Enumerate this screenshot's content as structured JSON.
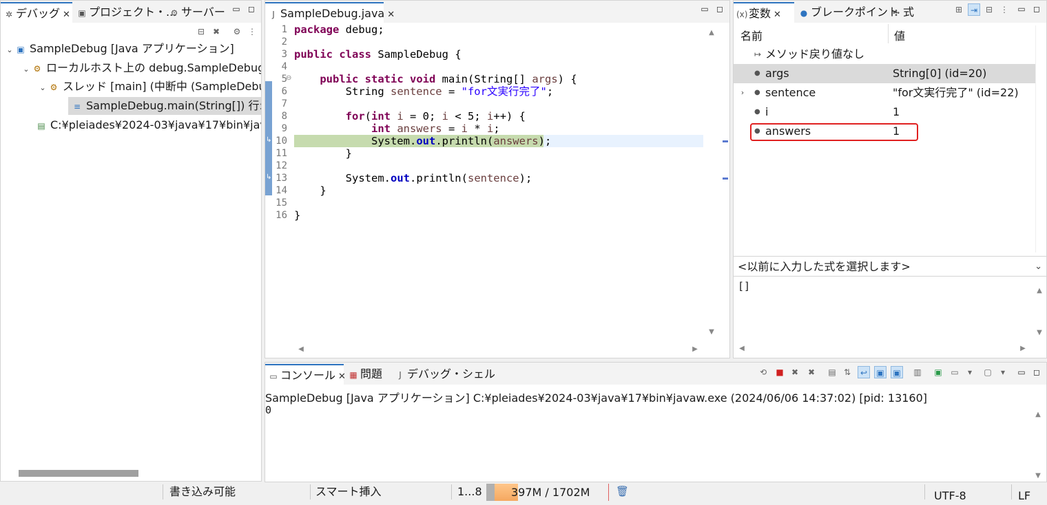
{
  "debug_view": {
    "tabs": [
      {
        "label": "デバッグ",
        "icon": "bug-icon"
      },
      {
        "label": "プロジェクト・...",
        "icon": "project-icon"
      },
      {
        "label": "サーバー",
        "icon": "server-icon"
      }
    ],
    "tree": [
      {
        "label": "SampleDebug [Java アプリケーション]"
      },
      {
        "label": "ローカルホスト上の debug.SampleDebug:"
      },
      {
        "label": "スレッド [main] (中断中 (SampleDebu"
      },
      {
        "label": "SampleDebug.main(String[]) 行:"
      },
      {
        "label": "C:¥pleiades¥2024-03¥java¥17¥bin¥jav"
      }
    ]
  },
  "editor": {
    "tab_label": "SampleDebug.java",
    "line_numbers": [
      "1",
      "2",
      "3",
      "4",
      "5",
      "6",
      "7",
      "8",
      "9",
      "10",
      "11",
      "12",
      "13",
      "14",
      "15",
      "16"
    ],
    "lines": {
      "l1_kw": "package",
      "l1_rest": " debug;",
      "l3_kw1": "public",
      "l3_kw2": "class",
      "l3_rest": " SampleDebug {",
      "l5_kw1": "public",
      "l5_kw2": "static",
      "l5_kw3": "void",
      "l5_rest1": " main(String[] ",
      "l5_var": "args",
      "l5_rest2": ") {",
      "l6_a": "String ",
      "l6_var": "sentence",
      "l6_b": " = ",
      "l6_str": "\"for文実行完了\"",
      "l6_c": ";",
      "l8_kw1": "for",
      "l8_a": "(",
      "l8_kw2": "int",
      "l8_var": " i",
      "l8_b": " = 0; ",
      "l8_var2": "i",
      "l8_c": " < 5; ",
      "l8_var3": "i",
      "l8_d": "++) {",
      "l9_kw": "int",
      "l9_var": " answers",
      "l9_a": " = ",
      "l9_var2": "i",
      "l9_b": " * ",
      "l9_var3": "i",
      "l9_c": ";",
      "l10_a": "System.",
      "l10_fld": "out",
      "l10_b": ".println(",
      "l10_var": "answers",
      "l10_c": ");",
      "l11": "}",
      "l13_a": "System.",
      "l13_fld": "out",
      "l13_b": ".println(",
      "l13_var": "sentence",
      "l13_c": ");",
      "l14": "}",
      "l16": "}"
    }
  },
  "variables_view": {
    "tabs": [
      {
        "label": "変数",
        "icon": "variables-icon"
      },
      {
        "label": "ブレークポイント",
        "icon": "breakpoint-icon"
      },
      {
        "label": "式",
        "icon": "expressions-icon"
      }
    ],
    "col_name": "名前",
    "col_value": "値",
    "rows": [
      {
        "name": "メソッド戻り値なし",
        "value": ""
      },
      {
        "name": "args",
        "value": "String[0]  (id=20)"
      },
      {
        "name": "sentence",
        "value": "\"for文実行完了\" (id=22)"
      },
      {
        "name": "i",
        "value": "1"
      },
      {
        "name": "answers",
        "value": "1"
      }
    ],
    "expression_placeholder": "<以前に入力した式を選択します>",
    "detail_text": "[]"
  },
  "console_view": {
    "tabs": [
      {
        "label": "コンソール",
        "icon": "console-icon"
      },
      {
        "label": "問題",
        "icon": "problems-icon"
      },
      {
        "label": "デバッグ・シェル",
        "icon": "debug-shell-icon"
      }
    ],
    "header": "SampleDebug [Java アプリケーション] C:¥pleiades¥2024-03¥java¥17¥bin¥javaw.exe  (2024/06/06 14:37:02) [pid: 13160]",
    "output": "0"
  },
  "status_bar": {
    "writable": "書き込み可能",
    "insert_mode": "スマート挿入",
    "position": "1...8",
    "memory": "397M / 1702M",
    "encoding": "UTF-8",
    "line_ending": "LF"
  },
  "colors": {
    "current_line_highlight": "#c6dbae",
    "accent": "#2e74c0",
    "highlight_box": "#e02020"
  }
}
